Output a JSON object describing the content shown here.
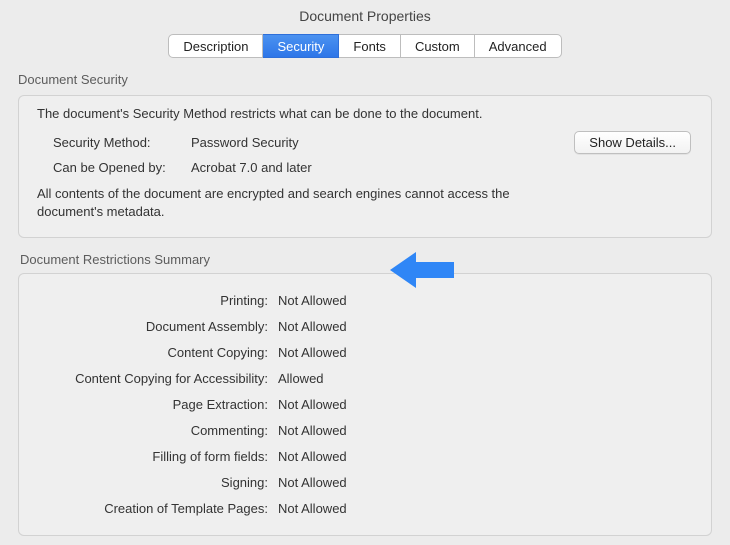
{
  "window": {
    "title": "Document Properties"
  },
  "tabs": {
    "items": [
      {
        "label": "Description",
        "active": false
      },
      {
        "label": "Security",
        "active": true
      },
      {
        "label": "Fonts",
        "active": false
      },
      {
        "label": "Custom",
        "active": false
      },
      {
        "label": "Advanced",
        "active": false
      }
    ]
  },
  "security": {
    "section_title": "Document Security",
    "intro": "The document's Security Method restricts what can be done to the document.",
    "method_label": "Security Method:",
    "method_value": "Password Security",
    "show_details": "Show Details...",
    "opened_by_label": "Can be Opened by:",
    "opened_by_value": "Acrobat 7.0 and later",
    "note": "All contents of the document are encrypted and search engines cannot access the document's metadata."
  },
  "restrictions": {
    "section_title": "Document Restrictions Summary",
    "items": [
      {
        "label": "Printing:",
        "value": "Not Allowed"
      },
      {
        "label": "Document Assembly:",
        "value": "Not Allowed"
      },
      {
        "label": "Content Copying:",
        "value": "Not Allowed"
      },
      {
        "label": "Content Copying for Accessibility:",
        "value": "Allowed"
      },
      {
        "label": "Page Extraction:",
        "value": "Not Allowed"
      },
      {
        "label": "Commenting:",
        "value": "Not Allowed"
      },
      {
        "label": "Filling of form fields:",
        "value": "Not Allowed"
      },
      {
        "label": "Signing:",
        "value": "Not Allowed"
      },
      {
        "label": "Creation of Template Pages:",
        "value": "Not Allowed"
      }
    ]
  },
  "annotation": {
    "arrow_color": "#2f86f6"
  }
}
